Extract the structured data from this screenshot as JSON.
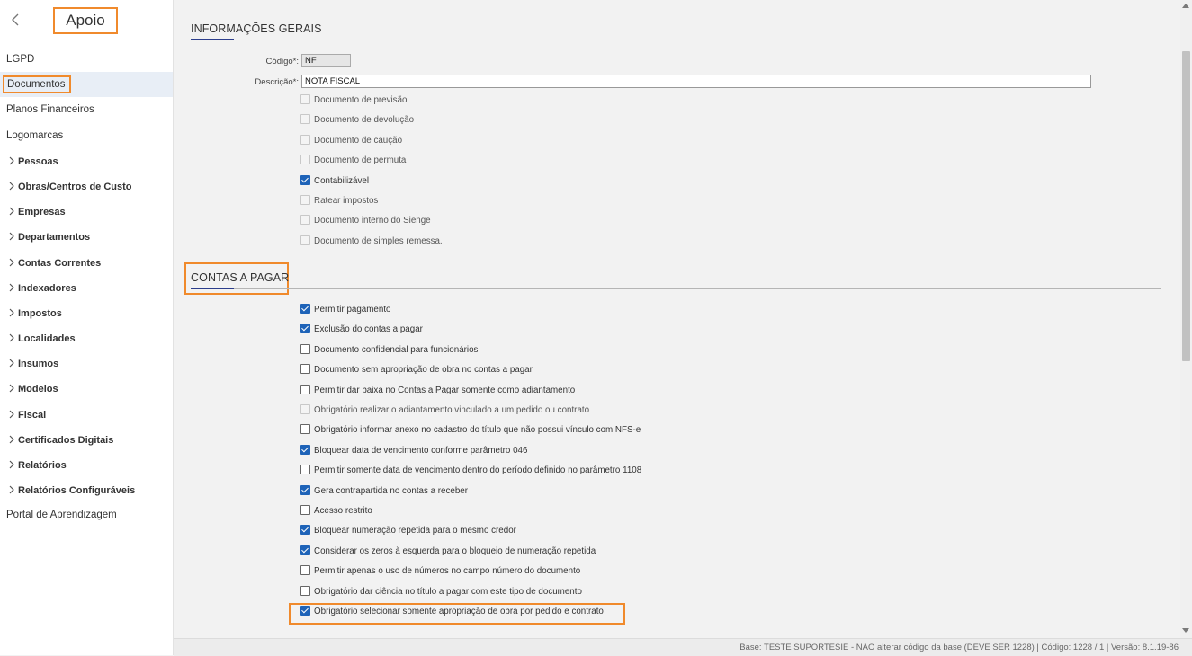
{
  "sidebar": {
    "title": "Apoio",
    "items": [
      {
        "label": "LGPD",
        "group": false
      },
      {
        "label": "Documentos",
        "group": false,
        "active": true
      },
      {
        "label": "Planos Financeiros",
        "group": false
      },
      {
        "label": "Logomarcas",
        "group": false
      },
      {
        "label": "Pessoas",
        "group": true
      },
      {
        "label": "Obras/Centros de Custo",
        "group": true
      },
      {
        "label": "Empresas",
        "group": true
      },
      {
        "label": "Departamentos",
        "group": true
      },
      {
        "label": "Contas Correntes",
        "group": true
      },
      {
        "label": "Indexadores",
        "group": true
      },
      {
        "label": "Impostos",
        "group": true
      },
      {
        "label": "Localidades",
        "group": true
      },
      {
        "label": "Insumos",
        "group": true
      },
      {
        "label": "Modelos",
        "group": true
      },
      {
        "label": "Fiscal",
        "group": true
      },
      {
        "label": "Certificados Digitais",
        "group": true
      },
      {
        "label": "Relatórios",
        "group": true
      },
      {
        "label": "Relatórios Configuráveis",
        "group": true
      },
      {
        "label": "Portal de Aprendizagem",
        "group": false
      }
    ]
  },
  "general": {
    "title": "INFORMAÇÕES GERAIS",
    "codigo_label": "Código*:",
    "codigo_value": "NF",
    "descricao_label": "Descrição*:",
    "descricao_value": "NOTA FISCAL",
    "options": [
      {
        "label": "Documento de previsão",
        "checked": false,
        "disabled": true
      },
      {
        "label": "Documento de devolução",
        "checked": false,
        "disabled": true
      },
      {
        "label": "Documento de caução",
        "checked": false,
        "disabled": true
      },
      {
        "label": "Documento de permuta",
        "checked": false,
        "disabled": true
      },
      {
        "label": "Contabilizável",
        "checked": true,
        "disabled": false
      },
      {
        "label": "Ratear impostos",
        "checked": false,
        "disabled": true
      },
      {
        "label": "Documento interno do Sienge",
        "checked": false,
        "disabled": true
      },
      {
        "label": "Documento de simples remessa.",
        "checked": false,
        "disabled": true
      }
    ]
  },
  "payables": {
    "title": "CONTAS A PAGAR",
    "options": [
      {
        "label": "Permitir pagamento",
        "checked": true,
        "disabled": false
      },
      {
        "label": "Exclusão do contas a pagar",
        "checked": true,
        "disabled": false
      },
      {
        "label": "Documento confidencial para funcionários",
        "checked": false,
        "disabled": false
      },
      {
        "label": "Documento sem apropriação de obra no contas a pagar",
        "checked": false,
        "disabled": false
      },
      {
        "label": "Permitir dar baixa no Contas a Pagar somente como adiantamento",
        "checked": false,
        "disabled": false
      },
      {
        "label": "Obrigatório realizar o adiantamento vinculado a um pedido ou contrato",
        "checked": false,
        "disabled": true
      },
      {
        "label": "Obrigatório informar anexo no cadastro do título que não possui vínculo com NFS-e",
        "checked": false,
        "disabled": false
      },
      {
        "label": "Bloquear data de vencimento conforme parâmetro 046",
        "checked": true,
        "disabled": false
      },
      {
        "label": "Permitir somente data de vencimento dentro do período definido no parâmetro 1108",
        "checked": false,
        "disabled": false
      },
      {
        "label": "Gera contrapartida no contas a receber",
        "checked": true,
        "disabled": false
      },
      {
        "label": "Acesso restrito",
        "checked": false,
        "disabled": false
      },
      {
        "label": "Bloquear numeração repetida para o mesmo credor",
        "checked": true,
        "disabled": false
      },
      {
        "label": "Considerar os zeros à esquerda para o bloqueio de numeração repetida",
        "checked": true,
        "disabled": false
      },
      {
        "label": "Permitir apenas o uso de números no campo número do documento",
        "checked": false,
        "disabled": false
      },
      {
        "label": "Obrigatório dar ciência no título a pagar com este tipo de documento",
        "checked": false,
        "disabled": false
      },
      {
        "label": "Obrigatório selecionar somente apropriação de obra por pedido e contrato",
        "checked": true,
        "disabled": false
      }
    ]
  },
  "status": {
    "text": "Base: TESTE SUPORTESIE - NÃO alterar código da base (DEVE SER 1228)  |  Código: 1228 / 1  |  Versão: 8.1.19-86"
  },
  "colors": {
    "highlight": "#f08a2c",
    "checkbox": "#1e63b8",
    "section_underline": "#2c3e8c"
  }
}
